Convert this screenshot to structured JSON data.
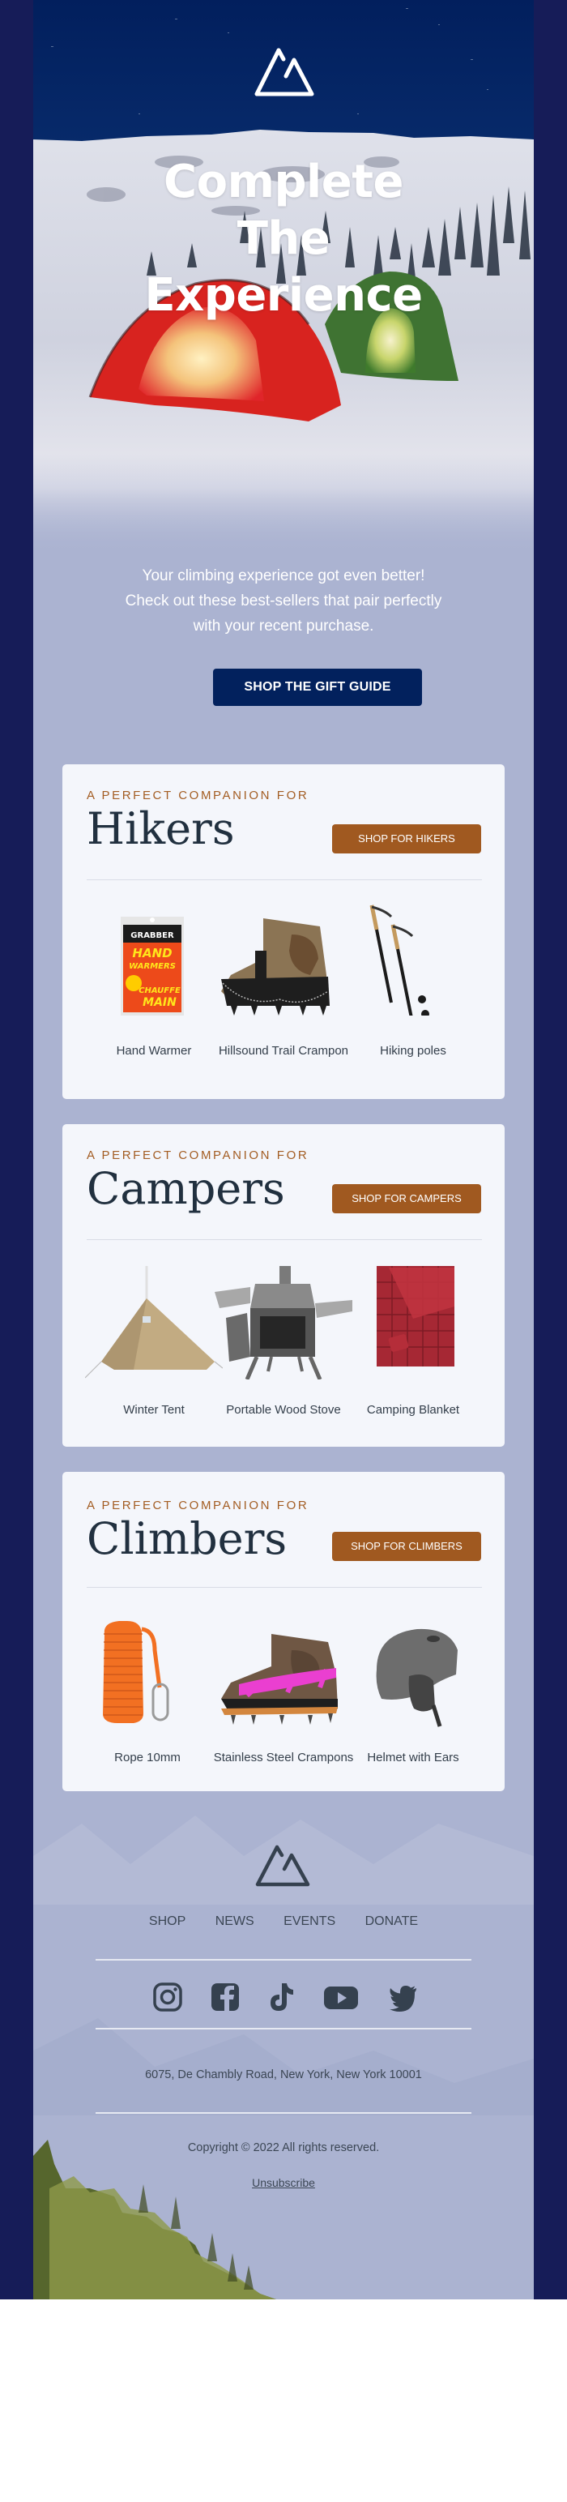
{
  "hero": {
    "title_lines": [
      "Complete",
      "The",
      "Experience"
    ],
    "intro_lines": [
      "Your climbing experience got even better!",
      "Check out these best-sellers that pair perfectly",
      "with your recent purchase."
    ],
    "cta_label": "SHOP THE GIFT GUIDE"
  },
  "sections": [
    {
      "eyebrow": "A PERFECT COMPANION FOR",
      "title": "Hikers",
      "button_label": "SHOP FOR HIKERS",
      "products": [
        {
          "name": "Hand Warmer",
          "icon": "hand-warmer-image",
          "pack_brand": "GRABBER",
          "pack_line1": "HAND",
          "pack_line2": "WARMERS",
          "pack_line3": "CHAUFFE",
          "pack_line4": "MAIN"
        },
        {
          "name": "Hillsound Trail Crampon",
          "icon": "crampon-boot-image"
        },
        {
          "name": "Hiking poles",
          "icon": "hiking-poles-image"
        }
      ]
    },
    {
      "eyebrow": "A PERFECT COMPANION FOR",
      "title": "Campers",
      "button_label": "SHOP FOR CAMPERS",
      "products": [
        {
          "name": "Winter Tent",
          "icon": "winter-tent-image"
        },
        {
          "name": "Portable Wood Stove",
          "icon": "wood-stove-image"
        },
        {
          "name": "Camping Blanket",
          "icon": "camping-blanket-image"
        }
      ]
    },
    {
      "eyebrow": "A PERFECT COMPANION FOR",
      "title": "Climbers",
      "button_label": "SHOP FOR CLIMBERS",
      "products": [
        {
          "name": "Rope 10mm",
          "icon": "rope-image"
        },
        {
          "name": "Stainless Steel Crampons",
          "icon": "steel-crampons-image"
        },
        {
          "name": "Helmet with Ears",
          "icon": "helmet-image"
        }
      ]
    }
  ],
  "footer": {
    "nav": [
      "SHOP",
      "NEWS",
      "EVENTS",
      "DONATE"
    ],
    "socials": [
      "instagram-icon",
      "facebook-icon",
      "tiktok-icon",
      "youtube-icon",
      "twitter-icon"
    ],
    "address": "6075, De Chambly Road, New York, New York 10001",
    "copyright": "Copyright © 2022 All rights reserved.",
    "unsubscribe": "Unsubscribe"
  },
  "colors": {
    "outer_background": "#161c58",
    "hero_sky": "#03215f",
    "cta_background": "#02215d",
    "card_background": "#f4f6fb",
    "accent_brown": "#a05920",
    "eyebrow": "#a35d23",
    "heading_text": "#21303f",
    "footer_text": "#3b4654"
  }
}
